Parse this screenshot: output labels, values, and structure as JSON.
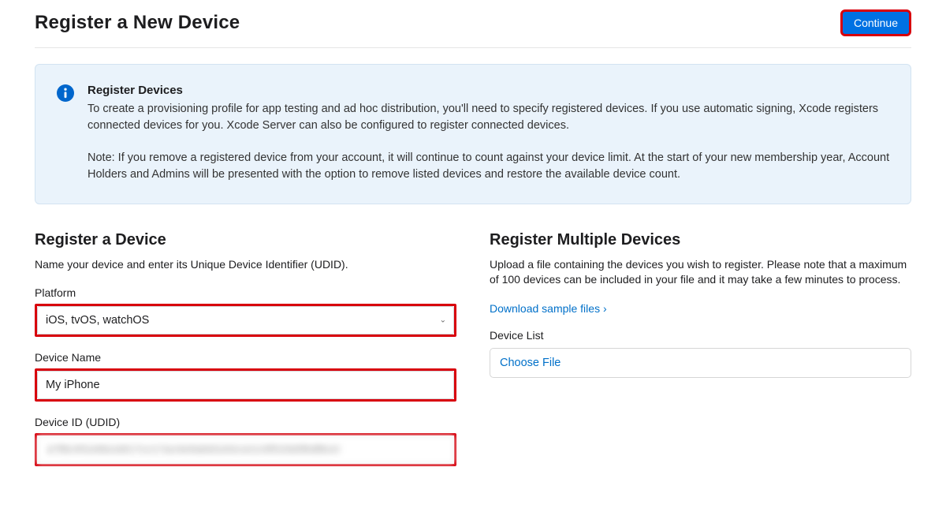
{
  "header": {
    "title": "Register a New Device",
    "continue_label": "Continue"
  },
  "info": {
    "title": "Register Devices",
    "para1": "To create a provisioning profile for app testing and ad hoc distribution, you'll need to specify registered devices. If you use automatic signing, Xcode registers connected devices for you. Xcode Server can also be configured to register connected devices.",
    "para2": "Note: If you remove a registered device from your account, it will continue to count against your device limit. At the start of your new membership year, Account Holders and Admins will be presented with the option to remove listed devices and restore the available device count."
  },
  "single": {
    "title": "Register a Device",
    "desc": "Name your device and enter its Unique Device Identifier (UDID).",
    "platform_label": "Platform",
    "platform_value": "iOS, tvOS, watchOS",
    "device_name_label": "Device Name",
    "device_name_value": "My iPhone",
    "device_id_label": "Device ID (UDID)",
    "device_id_value": "a7f8c4f1e6bce817cc17ac4e9a6d1e0cce1c0f51fa5fbdfbcd"
  },
  "multiple": {
    "title": "Register Multiple Devices",
    "desc": "Upload a file containing the devices you wish to register. Please note that a maximum of 100 devices can be included in your file and it may take a few minutes to process.",
    "download_link": "Download sample files ›",
    "device_list_label": "Device List",
    "choose_file": "Choose File"
  }
}
